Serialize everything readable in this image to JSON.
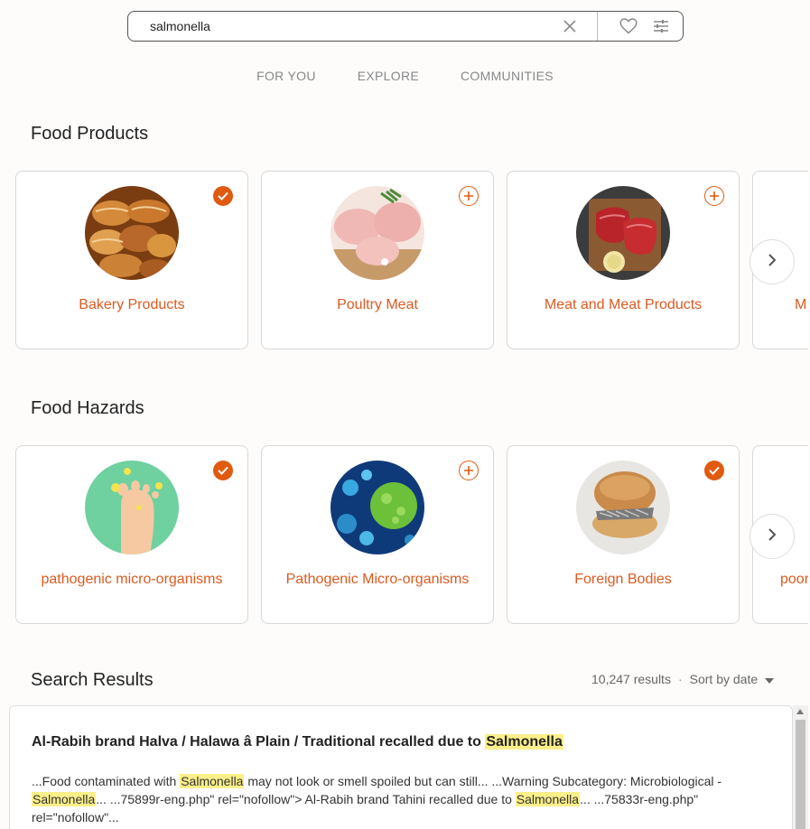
{
  "search": {
    "value": "salmonella",
    "placeholder": ""
  },
  "icons": {
    "clear": "close-icon",
    "favorite": "heart-icon",
    "filters": "sliders-icon"
  },
  "nav": {
    "tabs": [
      "FOR YOU",
      "EXPLORE",
      "COMMUNITIES"
    ]
  },
  "food_products": {
    "title": "Food Products",
    "cards": [
      {
        "label": "Bakery Products",
        "state": "selected"
      },
      {
        "label": "Poultry Meat",
        "state": "add"
      },
      {
        "label": "Meat and Meat Products",
        "state": "add"
      },
      {
        "label": "M",
        "state": "partial"
      }
    ]
  },
  "food_hazards": {
    "title": "Food Hazards",
    "cards": [
      {
        "label": "pathogenic micro-organisms",
        "state": "selected"
      },
      {
        "label": "Pathogenic Micro-organisms",
        "state": "add"
      },
      {
        "label": "Foreign Bodies",
        "state": "selected"
      },
      {
        "label": "poor",
        "state": "partial"
      }
    ]
  },
  "results": {
    "title": "Search Results",
    "count": "10,247 results",
    "separator": "·",
    "sort": "Sort by date",
    "items": [
      {
        "title_text": "Al-Rabih brand Halva / Halawa â   Plain / Traditional recalled due to ",
        "title_highlight": "Salmonella",
        "snippet_parts": [
          "...Food contaminated with ",
          "Salmonella",
          " may not look or smell spoiled but can still... ...Warning Subcategory: Microbiological - ",
          "Salmonella",
          "... ...75899r-eng.php\" rel=\"nofollow\"> Al-Rabih brand Tahini recalled due to ",
          "Salmonella",
          "... ...75833r-eng.php\" rel=\"nofollow\"..."
        ]
      }
    ]
  },
  "colors": {
    "accent": "#dd5a20",
    "highlight": "#fbef8a",
    "background": "#fdfcfb"
  }
}
